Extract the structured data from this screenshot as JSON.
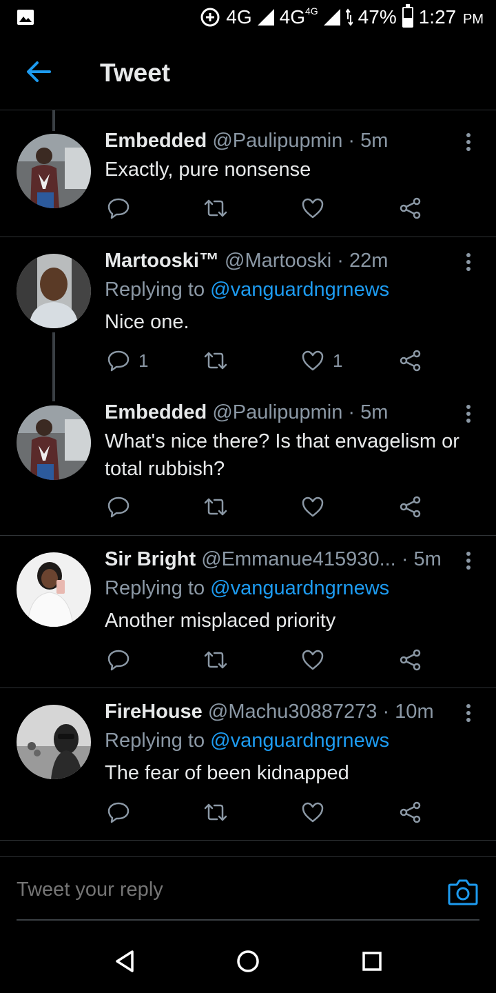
{
  "status_bar": {
    "network1": "4G",
    "network2": "4G",
    "network2_badge": "4G",
    "battery": "47%",
    "battery_level": 0.47,
    "time": "1:27",
    "ampm": "PM"
  },
  "header": {
    "title": "Tweet"
  },
  "tweets": [
    {
      "name": "Embedded",
      "handle": "@Paulipupmin",
      "time": "· 5m",
      "replying_prefix": "",
      "replying_to": "",
      "text": "Exactly, pure nonsense",
      "reply_count": "",
      "like_count": ""
    },
    {
      "name": "Martooski™",
      "handle": "@Martooski",
      "time": "· 22m",
      "replying_prefix": "Replying to",
      "replying_to": "@vanguardngrnews",
      "text": "Nice one.",
      "reply_count": "1",
      "like_count": "1"
    },
    {
      "name": "Embedded",
      "handle": "@Paulipupmin",
      "time": "· 5m",
      "replying_prefix": "",
      "replying_to": "",
      "text": "What's nice there? Is that envagelism or total rubbish?",
      "reply_count": "",
      "like_count": ""
    },
    {
      "name": "Sir Bright",
      "handle": "@Emmanue415930...",
      "time": "· 5m",
      "replying_prefix": "Replying to",
      "replying_to": "@vanguardngrnews",
      "text": "Another misplaced priority",
      "reply_count": "",
      "like_count": ""
    },
    {
      "name": "FireHouse",
      "handle": "@Machu30887273",
      "time": "· 10m",
      "replying_prefix": "Replying to",
      "replying_to": "@vanguardngrnews",
      "text": "The fear of been kidnapped",
      "reply_count": "",
      "like_count": ""
    }
  ],
  "reply_bar": {
    "placeholder": "Tweet your reply"
  },
  "colors": {
    "accent": "#1d9bf0",
    "muted": "#8b98a5",
    "background": "#000000"
  }
}
